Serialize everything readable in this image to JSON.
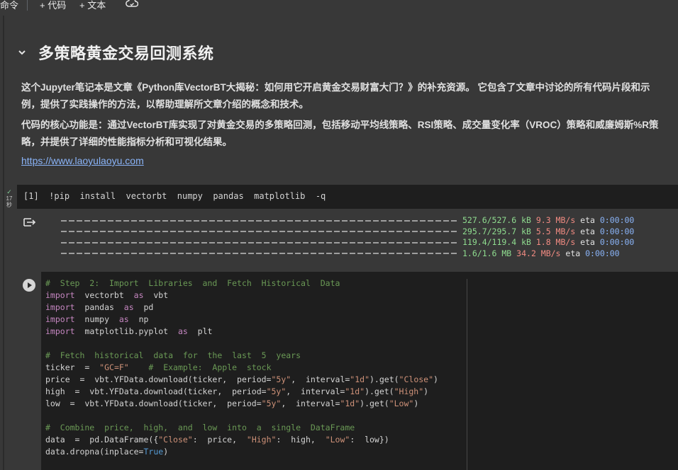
{
  "toolbar": {
    "command_label": "命令",
    "add_code_label": "+ 代码",
    "add_text_label": "+ 文本"
  },
  "markdown": {
    "title": "多策略黄金交易回测系统",
    "para1": "这个Jupyter笔记本是文章《Python库VectorBT大揭秘：如何用它开启黄金交易财富大门？》的补充资源。 它包含了文章中讨论的所有代码片段和示例，提供了实践操作的方法，以帮助理解所文章介绍的概念和技术。",
    "para2": "代码的核心功能是：通过VectorBT库实现了对黄金交易的多策略回测，包括移动平均线策略、RSI策略、成交量变化率（VROC）策略和威廉姆斯%R策略，并提供了详细的性能指标分析和可视化结果。",
    "link": "https://www.laoyulaoyu.com"
  },
  "cell1": {
    "exec_count": "[1]",
    "check": "✓",
    "time_value": "17",
    "time_unit": "秒",
    "code": "!pip  install  vectorbt  numpy  pandas  matplotlib  -q"
  },
  "output": {
    "progress": [
      {
        "size": "527.6/527.6 kB",
        "speed": "9.3 MB/s",
        "eta_label": "eta",
        "eta": "0:00:00",
        "fraction": 1.0
      },
      {
        "size": "295.7/295.7 kB",
        "speed": "5.5 MB/s",
        "eta_label": "eta",
        "eta": "0:00:00",
        "fraction": 1.0
      },
      {
        "size": "119.4/119.4 kB",
        "speed": "1.8 MB/s",
        "eta_label": "eta",
        "eta": "0:00:00",
        "fraction": 1.0
      },
      {
        "size": "1.6/1.6 MB",
        "speed": "34.2 MB/s",
        "eta_label": "eta",
        "eta": "0:00:00",
        "fraction": 1.0
      }
    ]
  },
  "cell2": {
    "lines": [
      "#  Step  2:  Import  Libraries  and  Fetch  Historical  Data",
      "import  vectorbt  as  vbt",
      "import  pandas  as  pd",
      "import  numpy  as  np",
      "import  matplotlib.pyplot  as  plt",
      "",
      "#  Fetch  historical  data  for  the  last  5  years",
      "ticker  =  \"GC=F\"    #  Example:  Apple  stock",
      "price  =  vbt.YFData.download(ticker,  period=\"5y\",  interval=\"1d\").get(\"Close\")",
      "high  =  vbt.YFData.download(ticker,  period=\"5y\",  interval=\"1d\").get(\"High\")",
      "low  =  vbt.YFData.download(ticker,  period=\"5y\",  interval=\"1d\").get(\"Low\")",
      "",
      "#  Combine  price,  high,  and  low  into  a  single  DataFrame",
      "data  =  pd.DataFrame({\"Close\":  price,  \"High\":  high,  \"Low\":  low})",
      "data.dropna(inplace=True)"
    ]
  }
}
